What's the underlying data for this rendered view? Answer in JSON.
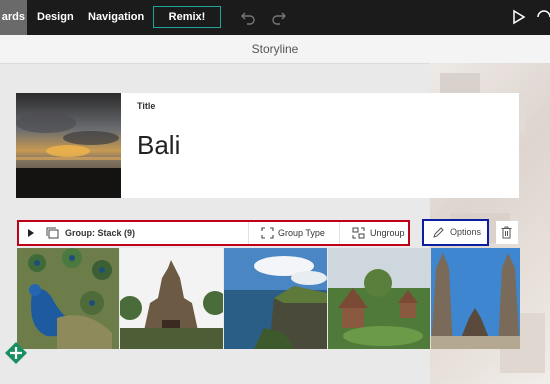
{
  "topbar": {
    "tabs": [
      {
        "label": "ards"
      },
      {
        "label": "Design"
      },
      {
        "label": "Navigation"
      }
    ],
    "remix_label": "Remix!"
  },
  "header": {
    "title": "Storyline"
  },
  "title_card": {
    "label": "Title",
    "value": "Bali"
  },
  "group_toolbar": {
    "group_label": "Group: Stack (9)",
    "group_type_label": "Group Type",
    "ungroup_label": "Ungroup"
  },
  "options_label": "Options",
  "colors": {
    "topbar": "#1b1b1b",
    "active_tab": "#6a6a6a",
    "remix_border": "#1fa39a",
    "group_highlight": "#c00018",
    "options_highlight": "#0b1f9e",
    "add_button": "#1a8f60"
  },
  "photos": [
    {
      "name": "peacock"
    },
    {
      "name": "temple-gate"
    },
    {
      "name": "sea-cliff"
    },
    {
      "name": "garden-shrine"
    },
    {
      "name": "split-gate"
    }
  ]
}
